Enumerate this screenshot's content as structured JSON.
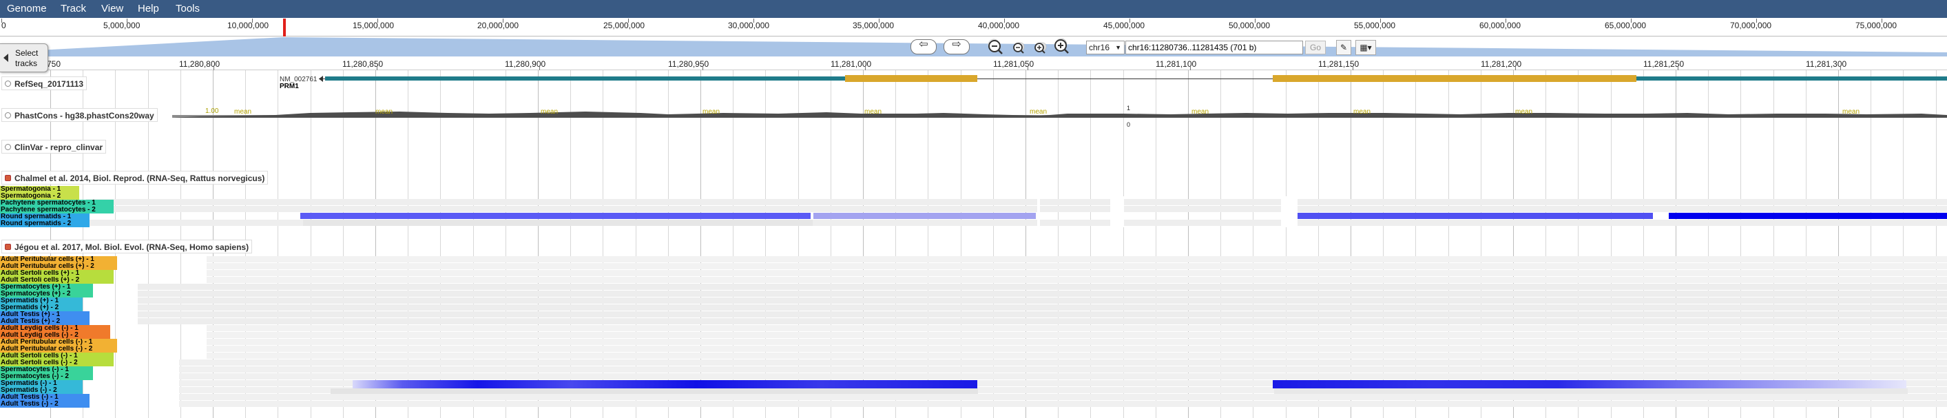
{
  "menu": [
    "Genome",
    "Track",
    "View",
    "Help",
    "Tools"
  ],
  "overview": {
    "labels": [
      "0",
      "5,000,000",
      "10,000,000",
      "15,000,000",
      "20,000,000",
      "25,000,000",
      "30,000,000",
      "35,000,000",
      "40,000,000",
      "45,000,000",
      "50,000,000",
      "55,000,000",
      "60,000,000",
      "65,000,000",
      "70,000,000",
      "75,000,000"
    ]
  },
  "navigation": {
    "chromosome": "chr16",
    "location": "chr16:11280736..11281435 (701 b)",
    "go_label": "Go",
    "select_tracks_label": "Select tracks"
  },
  "ruler": {
    "labels": [
      "750",
      "11,280,800",
      "11,280,850",
      "11,280,900",
      "11,280,950",
      "11,281,000",
      "11,281,050",
      "11,281,100",
      "11,281,150",
      "11,281,200",
      "11,281,250",
      "11,281,300"
    ]
  },
  "tracks": {
    "refseq": {
      "label": "RefSeq_20171113",
      "transcript": "NM_002761",
      "gene": "PRM1",
      "exon_color": "#d9a72c",
      "utr_color": "#1f7b8a"
    },
    "phastcons": {
      "label": "PhastCons - hg38.phastCons20way",
      "scale_top": "1",
      "scale_bottom": "0",
      "mean_labels": [
        "mean",
        "mean",
        "mean",
        "mean",
        "mean",
        "mean",
        "mean",
        "mean",
        "mean",
        "mean"
      ]
    },
    "clinvar": {
      "label": "ClinVar - repro_clinvar"
    },
    "chalmel": {
      "label": "Chalmel et al. 2014, Biol. Reprod. (RNA-Seq, Rattus norvegicus)",
      "samples": [
        {
          "name": "Spermatogonia - 1",
          "color": "#c8e04a"
        },
        {
          "name": "Spermatogonia - 2",
          "color": "#c8e04a"
        },
        {
          "name": "Pachytene spermatocytes - 1",
          "color": "#34d1a8"
        },
        {
          "name": "Pachytene spermatocytes - 2",
          "color": "#34d1a8"
        },
        {
          "name": "Round spermatids - 1",
          "color": "#2fa8e8"
        },
        {
          "name": "Round spermatids - 2",
          "color": "#2fa8e8"
        }
      ]
    },
    "jegou": {
      "label": "Jégou et al. 2017, Mol. Biol. Evol. (RNA-Seq, Homo sapiens)",
      "samples": [
        {
          "name": "Adult Peritubular cells (+) - 1",
          "color": "#f2b133"
        },
        {
          "name": "Adult Peritubular cells (+) - 2",
          "color": "#f2b133"
        },
        {
          "name": "Adult Sertoli cells (+) - 1",
          "color": "#b7dd3d"
        },
        {
          "name": "Adult Sertoli cells (+) - 2",
          "color": "#b7dd3d"
        },
        {
          "name": "Spermatocytes (+) - 1",
          "color": "#39d39a"
        },
        {
          "name": "Spermatocytes (+) - 2",
          "color": "#39d39a"
        },
        {
          "name": "Spermatids (+) - 1",
          "color": "#35b9d8"
        },
        {
          "name": "Spermatids (+) - 2",
          "color": "#35b9d8"
        },
        {
          "name": "Adult Testis (+) - 1",
          "color": "#3f8ef0"
        },
        {
          "name": "Adult Testis (+) - 2",
          "color": "#3f8ef0"
        },
        {
          "name": "Adult Leydig cells (-) - 1",
          "color": "#f07a2b"
        },
        {
          "name": "Adult Leydig cells (-) - 2",
          "color": "#f07a2b"
        },
        {
          "name": "Adult Peritubular cells (-) - 1",
          "color": "#f2b133"
        },
        {
          "name": "Adult Peritubular cells (-) - 2",
          "color": "#f2b133"
        },
        {
          "name": "Adult Sertoli cells (-) - 1",
          "color": "#b7dd3d"
        },
        {
          "name": "Adult Sertoli cells (-) - 2",
          "color": "#b7dd3d"
        },
        {
          "name": "Spermatocytes (-) - 1",
          "color": "#39d39a"
        },
        {
          "name": "Spermatocytes (-) - 2",
          "color": "#39d39a"
        },
        {
          "name": "Spermatids (-) - 1",
          "color": "#35b9d8"
        },
        {
          "name": "Spermatids (-) - 2",
          "color": "#35b9d8"
        },
        {
          "name": "Adult Testis (-) - 1",
          "color": "#3f8ef0"
        },
        {
          "name": "Adult Testis (-) - 2",
          "color": "#3f8ef0"
        }
      ]
    }
  },
  "colors": {
    "menubar": "#395a84",
    "signal_blue": "#0000ff",
    "signal_gray": "#e8e8e8",
    "chromosome_marker": "#e0201b"
  }
}
